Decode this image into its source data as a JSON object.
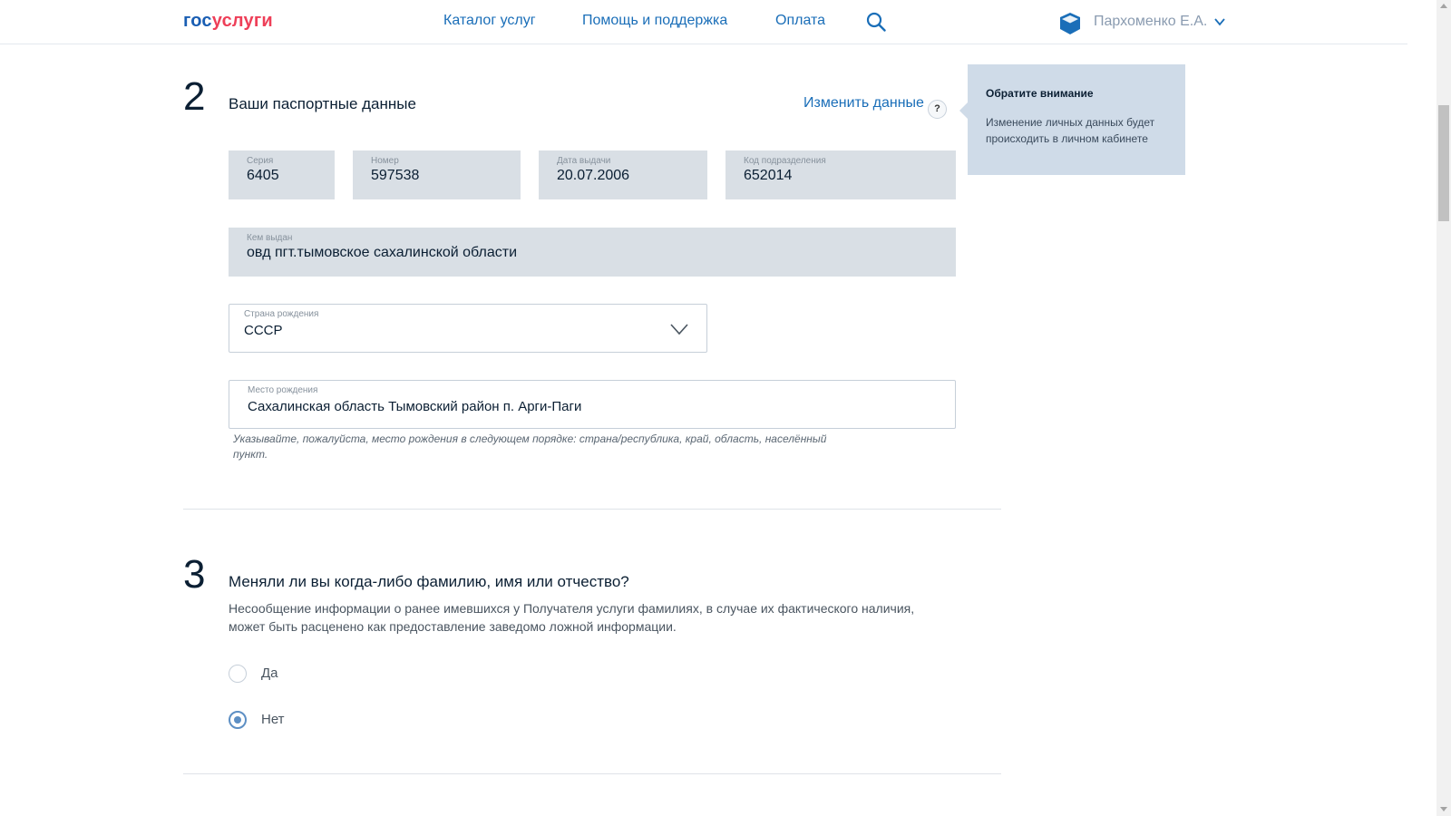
{
  "header": {
    "logo_part1": "гос",
    "logo_part2": "услуги",
    "nav": [
      "Каталог услуг",
      "Помощь и поддержка",
      "Оплата"
    ],
    "user_name": "Пархоменко Е.А."
  },
  "step2": {
    "number": "2",
    "title": "Ваши паспортные данные",
    "change_link": "Изменить данные",
    "help_label": "?",
    "tooltip": {
      "title": "Обратите внимание",
      "text": "Изменение личных данных будет происходить в личном кабинете"
    },
    "fields": {
      "series": {
        "label": "Серия",
        "value": "6405"
      },
      "number": {
        "label": "Номер",
        "value": "597538"
      },
      "issue_date": {
        "label": "Дата выдачи",
        "value": "20.07.2006"
      },
      "dept_code": {
        "label": "Код подразделения",
        "value": "652014"
      },
      "issued_by": {
        "label": "Кем выдан",
        "value": "овд пгт.тымовское сахалинской области"
      },
      "birth_country": {
        "label": "Страна рождения",
        "value": "СССР"
      },
      "birth_place": {
        "label": "Место рождения",
        "value": "Сахалинская область Тымовский район п. Арги-Паги"
      }
    },
    "hint": "Указывайте, пожалуйста, место рождения в следующем порядке: страна/республика, край, область, населённый пункт."
  },
  "step3": {
    "number": "3",
    "title": "Меняли ли вы когда-либо фамилию, имя или отчество?",
    "description": "Несообщение информации о ранее имевшихся у Получателя услуги фамилиях, в случае их фактического наличия, может быть расценено как предоставление заведомо ложной информации.",
    "options": [
      {
        "label": "Да",
        "selected": false
      },
      {
        "label": "Нет",
        "selected": true
      }
    ]
  },
  "colors": {
    "link": "#1a6eb8",
    "logo_blue": "#1a5eb3",
    "logo_red": "#ee3f58",
    "readonly_bg": "#d9dfe5",
    "tooltip_bg": "#cfdbe8",
    "radio_accent": "#5d8fc4"
  }
}
